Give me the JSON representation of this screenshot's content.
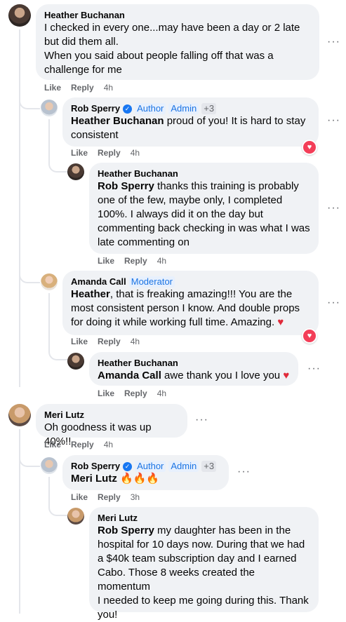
{
  "comments": {
    "c1": {
      "author": "Heather Buchanan",
      "line1": "I checked in every one...may have been a day or 2 late",
      "line2": "but did them all.",
      "line3": "When you said about people falling off that was a",
      "line4": "challenge for me",
      "like": "Like",
      "reply": "Reply",
      "time": "4h"
    },
    "c2": {
      "author": "Rob Sperry",
      "badge1": "Author",
      "badge2": "Admin",
      "badge3": "+3",
      "mention": "Heather Buchanan",
      "text1": " proud of you! It is hard to stay",
      "text2": "consistent",
      "like": "Like",
      "reply": "Reply",
      "time": "4h"
    },
    "c3": {
      "author": "Heather Buchanan",
      "mention": "Rob Sperry",
      "text1": " thanks this training is probably",
      "line2": "one of the few, maybe only, I completed",
      "line3": "100%. I always did it on the day but",
      "line4": "commenting back checking in was what I was",
      "line5": "late commenting on",
      "like": "Like",
      "reply": "Reply",
      "time": "4h"
    },
    "c4": {
      "author": "Amanda Call",
      "badge": "Moderator",
      "mention": "Heather",
      "text1": ", that is freaking amazing!!! You are the",
      "line2": "most consistent person I know. And double props",
      "line3": "for doing it while working full time. Amazing.",
      "emoji": "♥",
      "like": "Like",
      "reply": "Reply",
      "time": "4h"
    },
    "c5": {
      "author": "Heather Buchanan",
      "mention": "Amanda Call",
      "text1": " awe thank you I love you",
      "emoji": "♥",
      "like": "Like",
      "reply": "Reply",
      "time": "4h"
    },
    "c6": {
      "author": "Meri Lutz",
      "text": "Oh goodness it was up 40%!!",
      "like": "Like",
      "reply": "Reply",
      "time": "4h"
    },
    "c7": {
      "author": "Rob Sperry",
      "badge1": "Author",
      "badge2": "Admin",
      "badge3": "+3",
      "mention": "Meri Lutz",
      "emoji": "🔥🔥🔥",
      "like": "Like",
      "reply": "Reply",
      "time": "3h"
    },
    "c8": {
      "author": "Meri Lutz",
      "mention": "Rob Sperry",
      "text1": " my daughter has been in the",
      "line2": "hospital for 10 days now. During that we had",
      "line3": "a $40k team subscription day and I earned",
      "line4": "Cabo. Those 8 weeks created the momentum",
      "line5": "I needed to keep me going during this. Thank",
      "line6": "you!"
    }
  },
  "icons": {
    "more": "···",
    "verified": "✓",
    "love_reaction": "♥"
  },
  "colors": {
    "bubble": "#f0f2f5",
    "link_badge": "#1b74e4",
    "meta": "#65676b",
    "love": "#f33e58"
  }
}
